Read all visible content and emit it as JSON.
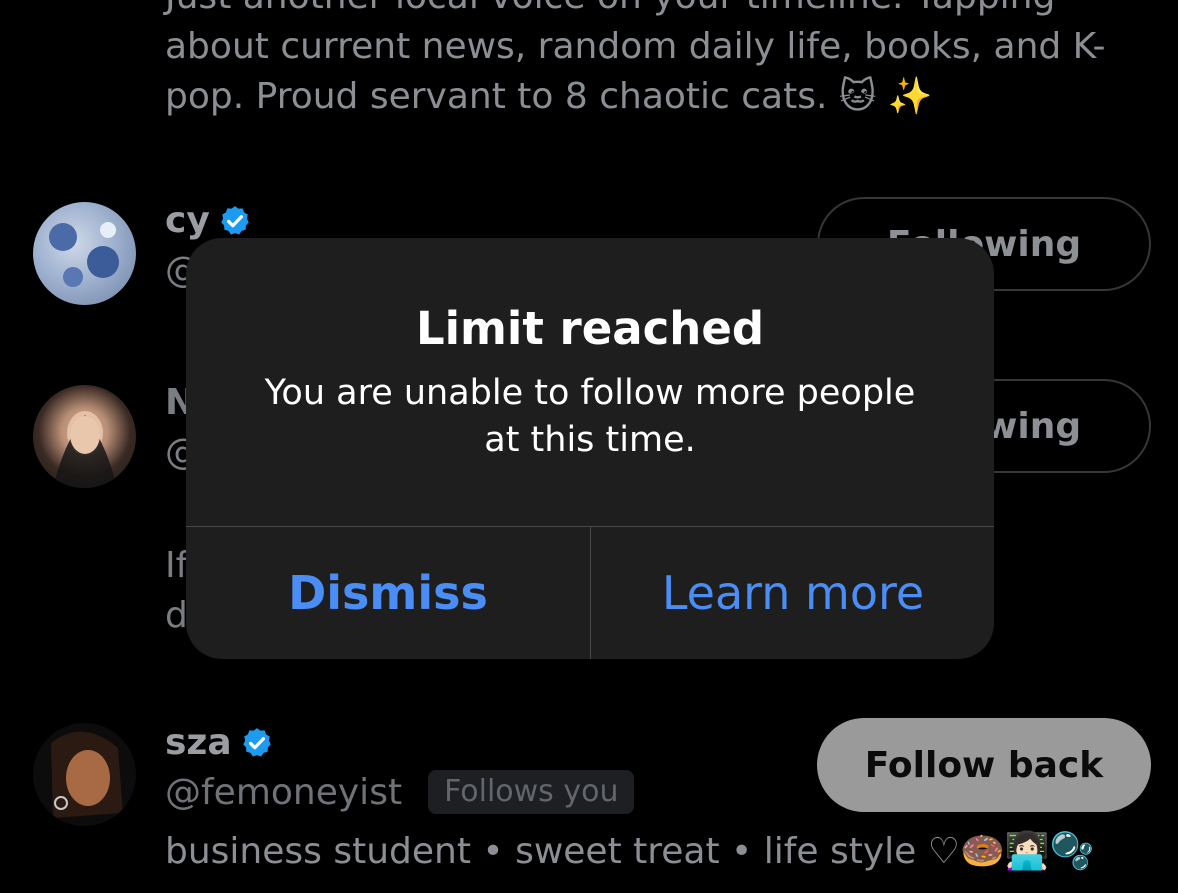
{
  "bio_above": {
    "text": "Just another local voice on your timeline. Yapping about current news, random daily life, books, and K-pop. Proud servant to 8 chaotic cats. 🐱 ✨"
  },
  "users": [
    {
      "name": "cy",
      "handle": "@",
      "button": "Following"
    },
    {
      "name": "N",
      "handle": "@",
      "button": "Following",
      "bio_fragments": [
        "If",
        "d"
      ]
    },
    {
      "name": "sza",
      "handle": "@femoneyist",
      "badge": "Follows you",
      "button": "Follow back",
      "bio": "business student • sweet treat • life style ♡🍩👩🏻‍💻🫧"
    }
  ],
  "alert": {
    "title": "Limit reached",
    "message": "You are unable to follow more people at this time.",
    "dismiss": "Dismiss",
    "learn_more": "Learn more"
  },
  "colors": {
    "background": "#000000",
    "alert_bg": "#1e1e1f",
    "action_blue": "#4a8ef5",
    "verified_blue": "#1d9bf0"
  },
  "icons": [
    "verified-badge-icon"
  ]
}
